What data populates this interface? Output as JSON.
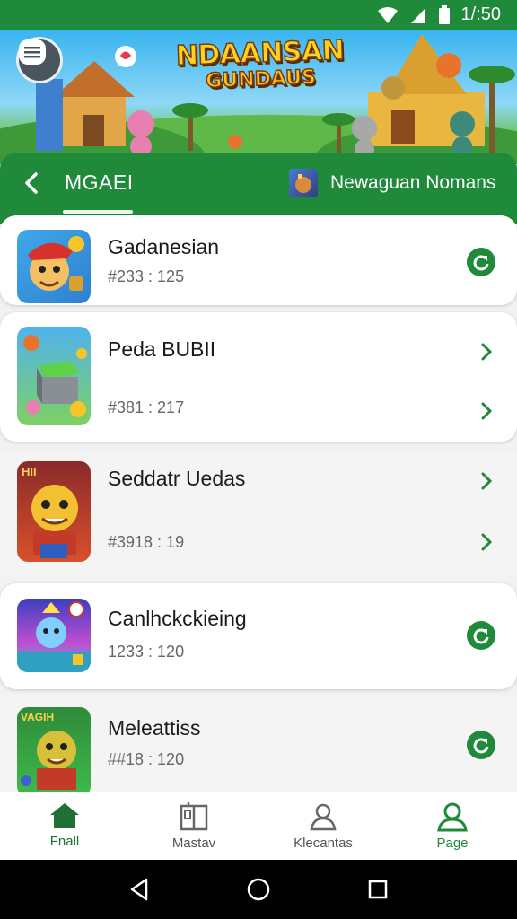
{
  "status_bar": {
    "time": "1/:50"
  },
  "banner": {
    "title_line1": "NDAANSAN",
    "title_line2": "GUNDAUS"
  },
  "tabs": {
    "active_tab": "MGAEI",
    "right_tab": "Newaguan Nomans"
  },
  "games": [
    {
      "name": "Gadanesian",
      "meta": "#233 : 125",
      "action": "refresh-icon"
    },
    {
      "name": "Peda BUBII",
      "meta": "#381 : 217",
      "action": "chevron-right-icon"
    },
    {
      "name": "Seddatr Uedas",
      "meta": "#3918 : 19",
      "action": "chevron-right-icon"
    },
    {
      "name": "Canlhckckieing",
      "meta": "1233 : 120",
      "action": "refresh-icon"
    },
    {
      "name": "Meleattiss",
      "meta": "##18 : 120",
      "action": "refresh-icon"
    }
  ],
  "thumb_labels": {
    "game3": "HII",
    "game5": "VAGIH"
  },
  "bottom_nav": [
    {
      "label": "Fnall",
      "icon": "home-icon"
    },
    {
      "label": "Mastav",
      "icon": "book-icon"
    },
    {
      "label": "Klecantas",
      "icon": "person-icon"
    },
    {
      "label": "Page",
      "icon": "profile-icon"
    }
  ],
  "colors": {
    "primary_green": "#1f8a3a",
    "background": "#f2f2f2",
    "card": "#ffffff"
  }
}
